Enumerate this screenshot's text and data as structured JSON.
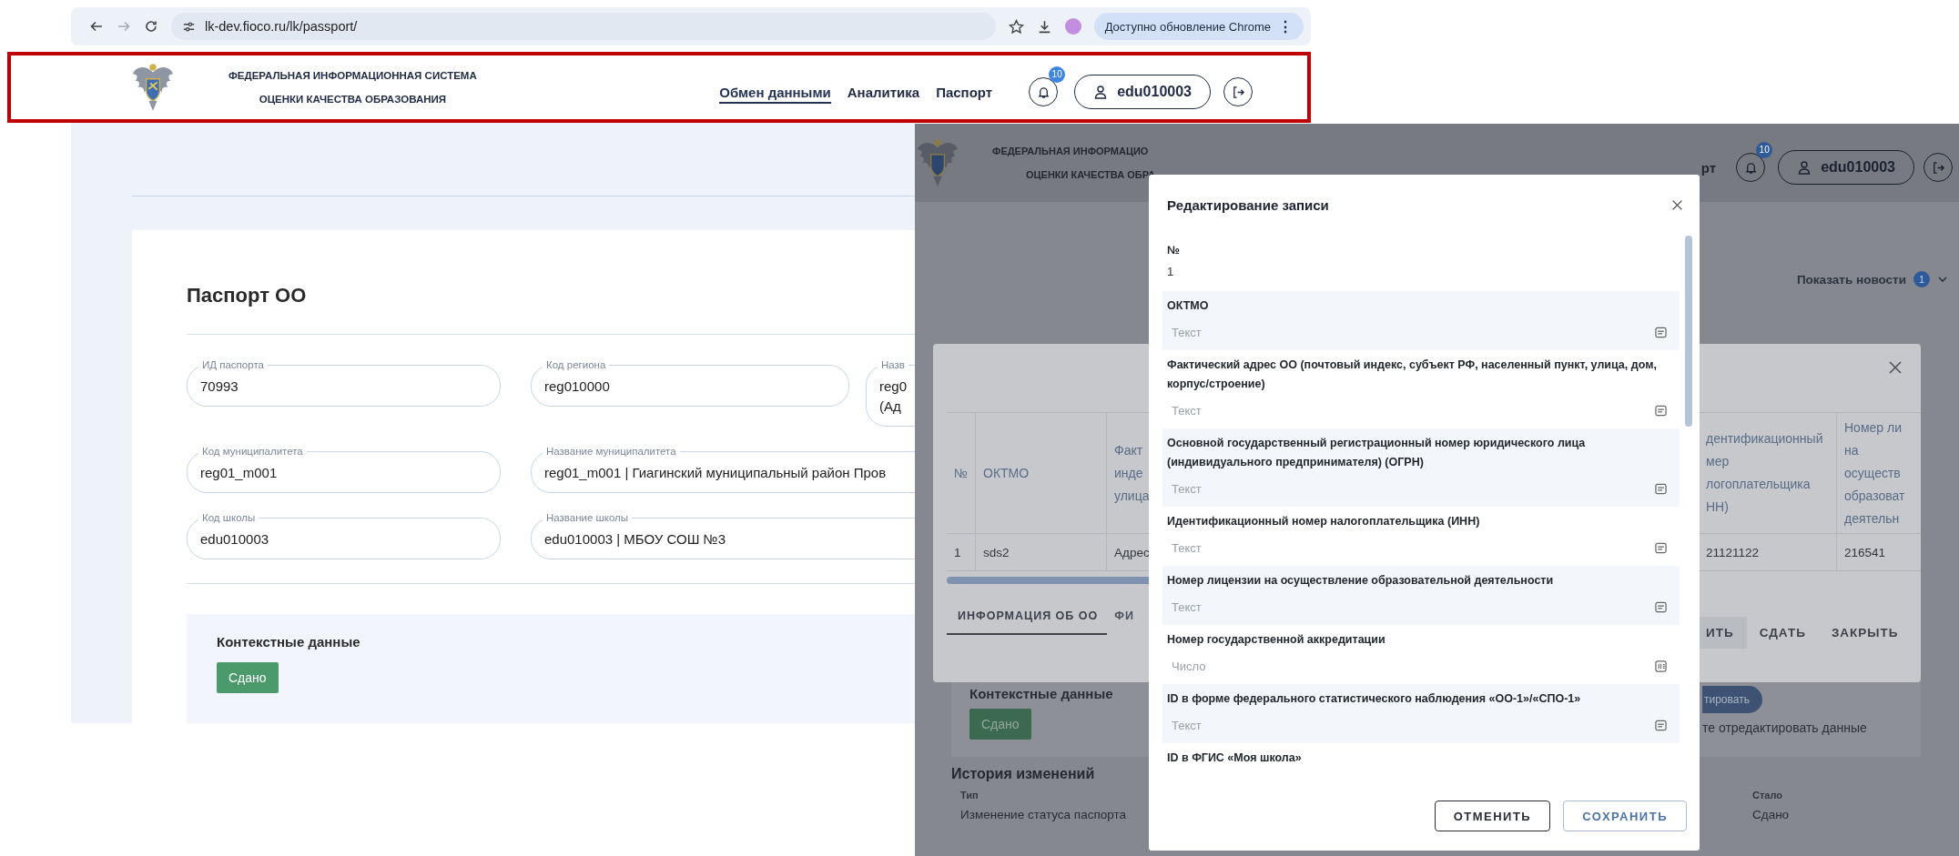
{
  "browser": {
    "url": "lk-dev.fioco.ru/lk/passport/",
    "update_button": "Доступно обновление Chrome",
    "update_menu": "⋮"
  },
  "header": {
    "title_lines": [
      "ФЕДЕРАЛЬНАЯ ИНФОРМАЦИОННАЯ СИСТЕМА",
      "ОЦЕНКИ КАЧЕСТВА ОБРАЗОВАНИЯ"
    ],
    "nav": [
      {
        "label": "Обмен данными",
        "selected": true
      },
      {
        "label": "Аналитика",
        "selected": false
      },
      {
        "label": "Паспорт",
        "selected": false
      }
    ],
    "notifications_badge": "10",
    "user": "edu010003"
  },
  "passport": {
    "title": "Паспорт ОО",
    "fields": [
      [
        {
          "label": "ИД паспорта",
          "value": [
            "70993"
          ]
        },
        {
          "label": "Код региона",
          "value": [
            "reg010000"
          ]
        },
        {
          "label": "Назв",
          "value": [
            "reg0",
            "(Ад"
          ]
        }
      ],
      [
        {
          "label": "Код муниципалитета",
          "value": [
            "reg01_m001"
          ]
        },
        {
          "label": "Название муниципалитета",
          "value": [
            "reg01_m001 | Гиагинский муниципальный район Пров"
          ]
        }
      ],
      [
        {
          "label": "Код школы",
          "value": [
            "edu010003"
          ]
        },
        {
          "label": "Название школы",
          "value": [
            "edu010003 | МБОУ СОШ №3"
          ]
        }
      ]
    ],
    "context": {
      "title": "Контекстные данные",
      "status": "Сдано"
    }
  },
  "second_screen": {
    "header": {
      "title_lines": [
        "ФЕДЕРАЛЬНАЯ ИНФОРМАЦИО",
        "ОЦЕНКИ КАЧЕСТВА ОБРА"
      ],
      "nav_fragment": "рт",
      "notifications_badge": "10",
      "user": "edu010003"
    },
    "news": {
      "label": "Показать новости",
      "count": "1"
    },
    "dialog": {
      "columns": [
        "№",
        "ОКТМО",
        "Факт\nинде\nулица",
        "дентификационный\nмер\nлогоплательщика\nНН)",
        "Номер ли\nна\nосуществ\nобразоват\nдеятельн"
      ],
      "row": [
        "1",
        "sds2",
        "Адрес",
        "21121122",
        "216541"
      ],
      "tabs": [
        {
          "label": "ИНФОРМАЦИЯ ОБ ОО",
          "selected": true
        },
        {
          "label": "ФИ",
          "selected": false
        }
      ],
      "buttons": [
        "ИТЬ",
        "СДАТЬ",
        "ЗАКРЫТЬ"
      ]
    },
    "context": {
      "title": "Контекстные данные",
      "status": "Сдано",
      "edit_button": "тировать",
      "hint": "те отредактировать данные"
    },
    "history": {
      "title": "История изменений",
      "columns": [
        "Тип",
        "Стало"
      ],
      "rows": [
        [
          "Изменение статуса паспорта",
          "Сдано"
        ]
      ]
    },
    "modal": {
      "title": "Редактирование записи",
      "fields": [
        {
          "label": "№",
          "kind": "value",
          "value": "1"
        },
        {
          "label": "ОКТМО",
          "kind": "text",
          "placeholder": "Текст"
        },
        {
          "label": "Фактический адрес ОО (почтовый индекс, субъект РФ, населенный пункт, улица, дом, корпус/строение)",
          "kind": "text",
          "placeholder": "Текст"
        },
        {
          "label": "Основной государственный регистрационный номер юридического лица (индивидуального предпринимателя) (ОГРН)",
          "kind": "text",
          "placeholder": "Текст"
        },
        {
          "label": "Идентификационный номер налогоплательщика (ИНН)",
          "kind": "text",
          "placeholder": "Текст"
        },
        {
          "label": "Номер лицензии на осуществление образовательной деятельности",
          "kind": "text",
          "placeholder": "Текст"
        },
        {
          "label": "Номер государственной аккредитации",
          "kind": "number",
          "placeholder": "Число"
        },
        {
          "label": "ID в форме федерального статистического наблюдения «ОО-1»/«СПО-1»",
          "kind": "text",
          "placeholder": "Текст"
        },
        {
          "label": "ID в ФГИС «Моя школа»",
          "kind": "text"
        }
      ],
      "buttons": [
        {
          "label": "ОТМЕНИТЬ",
          "kind": "secondary"
        },
        {
          "label": "СОХРАНИТЬ",
          "kind": "primary"
        }
      ]
    }
  }
}
